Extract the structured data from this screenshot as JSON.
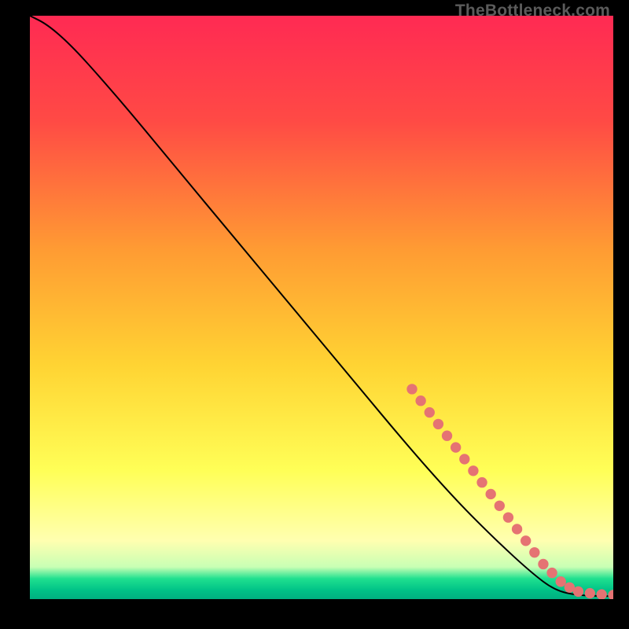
{
  "watermark": "TheBottleneck.com",
  "chart_data": {
    "type": "line",
    "title": "",
    "xlabel": "",
    "ylabel": "",
    "xlim": [
      0,
      100
    ],
    "ylim": [
      0,
      100
    ],
    "grid": false,
    "legend": false,
    "background_gradient": {
      "stops": [
        {
          "offset": 0.0,
          "color": "#ff2a53"
        },
        {
          "offset": 0.18,
          "color": "#ff4a45"
        },
        {
          "offset": 0.4,
          "color": "#ff9b33"
        },
        {
          "offset": 0.6,
          "color": "#ffd433"
        },
        {
          "offset": 0.78,
          "color": "#ffff57"
        },
        {
          "offset": 0.9,
          "color": "#ffffb0"
        },
        {
          "offset": 0.945,
          "color": "#c8ffb4"
        },
        {
          "offset": 0.965,
          "color": "#1fe08f"
        },
        {
          "offset": 0.985,
          "color": "#00c287"
        },
        {
          "offset": 1.0,
          "color": "#00b080"
        }
      ]
    },
    "series": [
      {
        "name": "curve",
        "stroke": "#000000",
        "points": [
          {
            "x": 0.0,
            "y": 100.0
          },
          {
            "x": 3.0,
            "y": 98.5
          },
          {
            "x": 7.0,
            "y": 95.0
          },
          {
            "x": 12.0,
            "y": 89.5
          },
          {
            "x": 18.0,
            "y": 82.5
          },
          {
            "x": 25.0,
            "y": 74.0
          },
          {
            "x": 35.0,
            "y": 62.0
          },
          {
            "x": 45.0,
            "y": 50.0
          },
          {
            "x": 55.0,
            "y": 38.0
          },
          {
            "x": 65.0,
            "y": 26.0
          },
          {
            "x": 73.0,
            "y": 17.0
          },
          {
            "x": 80.0,
            "y": 10.0
          },
          {
            "x": 86.0,
            "y": 4.5
          },
          {
            "x": 90.0,
            "y": 1.5
          },
          {
            "x": 94.0,
            "y": 0.6
          },
          {
            "x": 100.0,
            "y": 0.5
          }
        ]
      }
    ],
    "markers": {
      "name": "dotted-overlay",
      "color": "#e57373",
      "radius_pct": 0.9,
      "points": [
        {
          "x": 65.5,
          "y": 36.0
        },
        {
          "x": 67.0,
          "y": 34.0
        },
        {
          "x": 68.5,
          "y": 32.0
        },
        {
          "x": 70.0,
          "y": 30.0
        },
        {
          "x": 71.5,
          "y": 28.0
        },
        {
          "x": 73.0,
          "y": 26.0
        },
        {
          "x": 74.5,
          "y": 24.0
        },
        {
          "x": 76.0,
          "y": 22.0
        },
        {
          "x": 77.5,
          "y": 20.0
        },
        {
          "x": 79.0,
          "y": 18.0
        },
        {
          "x": 80.5,
          "y": 16.0
        },
        {
          "x": 82.0,
          "y": 14.0
        },
        {
          "x": 83.5,
          "y": 12.0
        },
        {
          "x": 85.0,
          "y": 10.0
        },
        {
          "x": 86.5,
          "y": 8.0
        },
        {
          "x": 88.0,
          "y": 6.0
        },
        {
          "x": 89.5,
          "y": 4.5
        },
        {
          "x": 91.0,
          "y": 3.0
        },
        {
          "x": 92.5,
          "y": 2.0
        },
        {
          "x": 94.0,
          "y": 1.3
        },
        {
          "x": 96.0,
          "y": 1.0
        },
        {
          "x": 98.0,
          "y": 0.8
        },
        {
          "x": 100.0,
          "y": 0.7
        }
      ]
    }
  }
}
